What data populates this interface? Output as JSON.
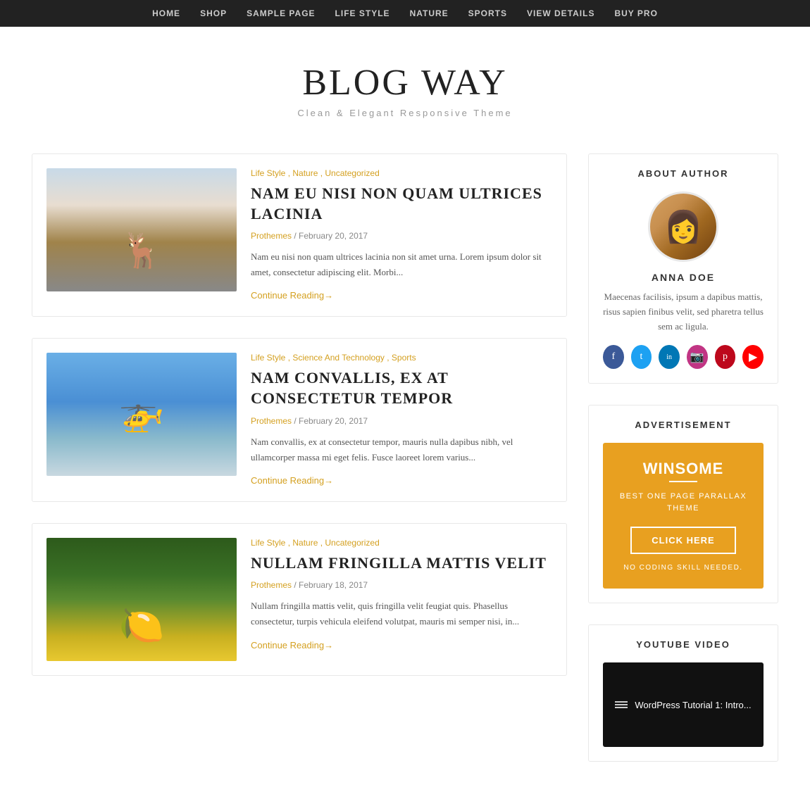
{
  "nav": {
    "items": [
      {
        "label": "HOME",
        "href": "#"
      },
      {
        "label": "SHOP",
        "href": "#"
      },
      {
        "label": "SAMPLE PAGE",
        "href": "#"
      },
      {
        "label": "LIFE STYLE",
        "href": "#"
      },
      {
        "label": "NATURE",
        "href": "#"
      },
      {
        "label": "SPORTS",
        "href": "#"
      },
      {
        "label": "VIEW DETAILS",
        "href": "#"
      },
      {
        "label": "BUY PRO",
        "href": "#"
      }
    ]
  },
  "header": {
    "title": "BLOG WAY",
    "tagline": "Clean & Elegant Responsive Theme"
  },
  "articles": [
    {
      "id": "article-1",
      "image_type": "deer",
      "categories": "Life Style , Nature , Uncategorized",
      "title": "NAM EU NISI NON QUAM ULTRICES LACINIA",
      "author": "Prothemes",
      "date": "February 20, 2017",
      "excerpt": "Nam eu nisi non quam ultrices lacinia non sit amet urna. Lorem ipsum dolor sit amet, consectetur adipiscing elit. Morbi...",
      "continue_label": "Continue Reading→"
    },
    {
      "id": "article-2",
      "image_type": "drone",
      "categories": "Life Style , Science And Technology , Sports",
      "title": "NAM CONVALLIS, EX AT CONSECTETUR TEMPOR",
      "author": "Prothemes",
      "date": "February 20, 2017",
      "excerpt": "Nam convallis, ex at consectetur tempor, mauris nulla dapibus nibh, vel ullamcorper massa mi eget felis. Fusce laoreet lorem varius...",
      "continue_label": "Continue Reading→"
    },
    {
      "id": "article-3",
      "image_type": "lemons",
      "categories": "Life Style , Nature , Uncategorized",
      "title": "NULLAM FRINGILLA MATTIS VELIT",
      "author": "Prothemes",
      "date": "February 18, 2017",
      "excerpt": "Nullam fringilla mattis velit, quis fringilla velit feugiat quis. Phasellus consectetur, turpis vehicula eleifend volutpat, mauris mi semper nisi, in...",
      "continue_label": "Continue Reading→"
    }
  ],
  "sidebar": {
    "about": {
      "section_title": "ABOUT AUTHOR",
      "author_name": "ANNA DOE",
      "author_bio": "Maecenas facilisis, ipsum a dapibus mattis, risus sapien finibus velit, sed pharetra tellus sem ac ligula.",
      "social": [
        {
          "name": "facebook",
          "icon": "f"
        },
        {
          "name": "twitter",
          "icon": "t"
        },
        {
          "name": "linkedin",
          "icon": "in"
        },
        {
          "name": "instagram",
          "icon": "📷"
        },
        {
          "name": "pinterest",
          "icon": "p"
        },
        {
          "name": "youtube",
          "icon": "▶"
        }
      ]
    },
    "advertisement": {
      "section_title": "ADVERTISEMENT",
      "ad_title": "WINSOME",
      "ad_subtitle": "BEST ONE PAGE PARALLAX THEME",
      "button_label": "CLICK HERE",
      "ad_note": "NO CODING SKILL NEEDED."
    },
    "youtube": {
      "section_title": "YOUTUBE VIDEO",
      "video_title": "WordPress Tutorial 1: Intro..."
    }
  }
}
